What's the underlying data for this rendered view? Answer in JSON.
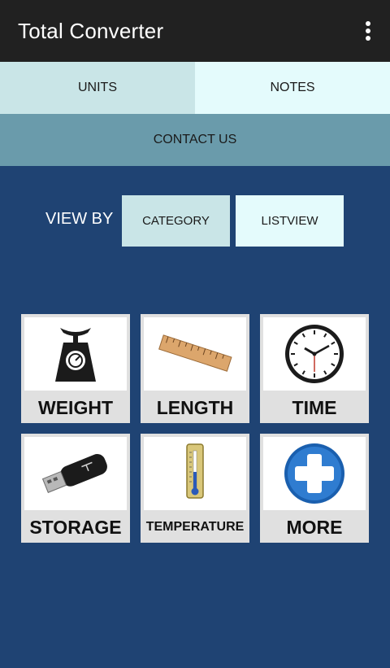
{
  "app": {
    "title": "Total Converter",
    "menu_icon": "overflow-menu-icon"
  },
  "tabs": {
    "units": "UNITS",
    "notes": "NOTES",
    "contact": "CONTACT US"
  },
  "view": {
    "label": "VIEW BY",
    "category": "CATEGORY",
    "listview": "LISTVIEW"
  },
  "categories": [
    {
      "label": "WEIGHT",
      "icon": "scale-icon"
    },
    {
      "label": "LENGTH",
      "icon": "ruler-icon"
    },
    {
      "label": "TIME",
      "icon": "clock-icon"
    },
    {
      "label": "STORAGE",
      "icon": "usb-drive-icon"
    },
    {
      "label": "TEMPERATURE",
      "icon": "thermometer-icon"
    },
    {
      "label": "MORE",
      "icon": "plus-circle-icon"
    }
  ],
  "colors": {
    "background": "#1f4373",
    "appbar": "#212121",
    "tab_units": "#c9e5e7",
    "tab_notes": "#e4fbfc",
    "contact": "#6a9bab"
  }
}
